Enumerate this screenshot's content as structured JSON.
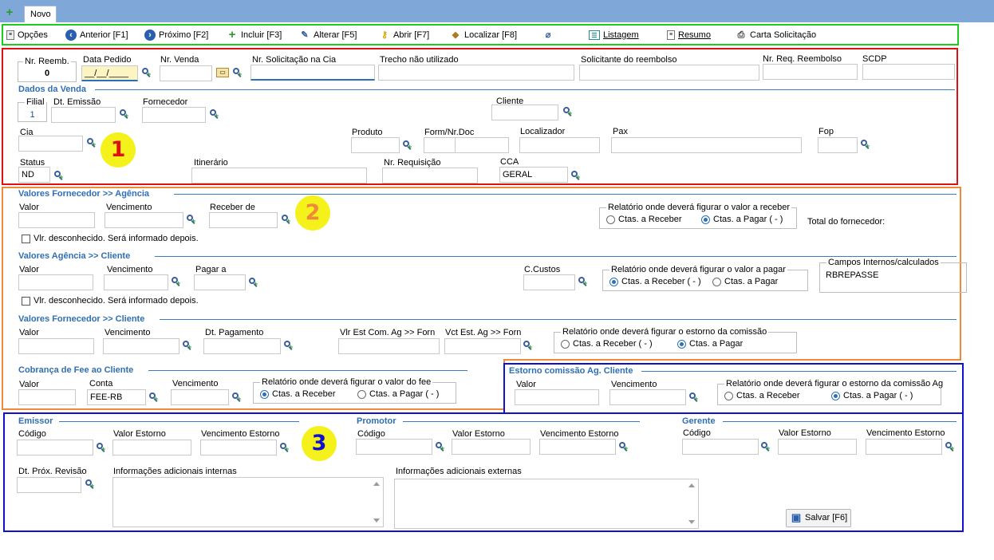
{
  "tabs": {
    "new_tab": "Novo"
  },
  "toolbar": [
    {
      "label": "Opções",
      "icon": "options-icon"
    },
    {
      "label": "Anterior [F1]",
      "icon": "previous-icon"
    },
    {
      "label": "Próximo [F2]",
      "icon": "next-icon"
    },
    {
      "label": "Incluir [F3]",
      "icon": "add-icon"
    },
    {
      "label": "Alterar [F5]",
      "icon": "edit-icon"
    },
    {
      "label": "Abrir [F7]",
      "icon": "key-icon"
    },
    {
      "label": "Localizar [F8]",
      "icon": "locate-icon"
    },
    {
      "label": "",
      "icon": "attachment-icon"
    },
    {
      "label": "Listagem",
      "icon": "list-icon"
    },
    {
      "label": "Resumo",
      "icon": "summary-icon"
    },
    {
      "label": "Carta Solicitação",
      "icon": "printer-icon"
    }
  ],
  "markers": [
    "1",
    "2",
    "3"
  ],
  "header": {
    "nr_reemb_label": "Nr. Reemb.",
    "nr_reemb_value": "0",
    "data_pedido_label": "Data Pedido",
    "data_pedido_value": "__/__/____",
    "nr_venda_label": "Nr. Venda",
    "nr_solicitacao_label": "Nr. Solicitação na Cia",
    "trecho_label": "Trecho não utilizado",
    "solicitante_label": "Solicitante do reembolso",
    "nr_req_label": "Nr. Req. Reembolso",
    "scdp_label": "SCDP"
  },
  "venda": {
    "title": "Dados da Venda",
    "filial_label": "Filial",
    "filial_value": "1",
    "dt_emissao_label": "Dt. Emissão",
    "fornecedor_label": "Fornecedor",
    "cliente_label": "Cliente",
    "cia_label": "Cia",
    "produto_label": "Produto",
    "form_label": "Form/Nr.Doc",
    "localizador_label": "Localizador",
    "pax_label": "Pax",
    "fop_label": "Fop",
    "status_label": "Status",
    "status_value": "ND",
    "itinerario_label": "Itinerário",
    "nr_requisicao_label": "Nr. Requisição",
    "cca_label": "CCA",
    "cca_value": "GERAL"
  },
  "forn_agencia": {
    "title": "Valores Fornecedor >> Agência",
    "valor_label": "Valor",
    "vencimento_label": "Vencimento",
    "receber_label": "Receber de",
    "checkbox_label": "Vlr. desconhecido. Será informado depois.",
    "group_label": "Relatório onde deverá figurar o valor a receber",
    "opt1": "Ctas. a Receber",
    "opt2": "Ctas. a Pagar ( - )",
    "total_label": "Total do fornecedor:"
  },
  "agencia_cliente": {
    "title": "Valores Agência >> Cliente",
    "valor_label": "Valor",
    "vencimento_label": "Vencimento",
    "pagar_label": "Pagar a",
    "ccustos_label": "C.Custos",
    "checkbox_label": "Vlr. desconhecido. Será informado depois.",
    "group_label": "Relatório onde deverá figurar o valor a pagar",
    "opt1": "Ctas. a Receber ( - )",
    "opt2": "Ctas. a Pagar",
    "campos_label": "Campos Internos/calculados",
    "campos_value": "RBREPASSE"
  },
  "forn_cliente": {
    "title": "Valores Fornecedor >> Cliente",
    "valor_label": "Valor",
    "vencimento_label": "Vencimento",
    "dt_pag_label": "Dt. Pagamento",
    "vlr_est_label": "Vlr Est Com. Ag >> Forn",
    "vct_est_label": "Vct Est. Ag >> Forn",
    "group_label": "Relatório onde deverá figurar o estorno da comissão",
    "opt1": "Ctas. a Receber ( - )",
    "opt2": "Ctas. a Pagar"
  },
  "fee": {
    "title": "Cobrança de Fee ao Cliente",
    "valor_label": "Valor",
    "conta_label": "Conta",
    "conta_value": "FEE-RB",
    "vencimento_label": "Vencimento",
    "group_label": "Relatório onde deverá figurar o valor do fee",
    "opt1": "Ctas. a Receber",
    "opt2": "Ctas. a Pagar ( - )"
  },
  "estorno": {
    "title": "Estorno comissão Ag. Cliente",
    "valor_label": "Valor",
    "vencimento_label": "Vencimento",
    "group_label": "Relatório onde deverá figurar o estorno da comissão Ag",
    "opt1": "Ctas. a Receber",
    "opt2": "Ctas. a Pagar ( - )"
  },
  "emissor": {
    "title": "Emissor",
    "codigo_label": "Código",
    "valor_label": "Valor Estorno",
    "venc_label": "Vencimento Estorno"
  },
  "promotor": {
    "title": "Promotor",
    "codigo_label": "Código",
    "valor_label": "Valor Estorno",
    "venc_label": "Vencimento Estorno"
  },
  "gerente": {
    "title": "Gerente",
    "codigo_label": "Código",
    "valor_label": "Valor Estorno",
    "venc_label": "Vencimento Estorno"
  },
  "bottom": {
    "dt_prox_label": "Dt. Próx. Revisão",
    "info_int_label": "Informações adicionais internas",
    "info_ext_label": "Informações adicionais externas",
    "save_label": "Salvar [F6]"
  },
  "colors": {
    "toolbar_border": "#1ccd1c",
    "section1": "#e01010",
    "section2": "#f08a3a",
    "section3": "#1010d0",
    "section_title": "#2f6fb5",
    "marker": "#f5f11a"
  }
}
